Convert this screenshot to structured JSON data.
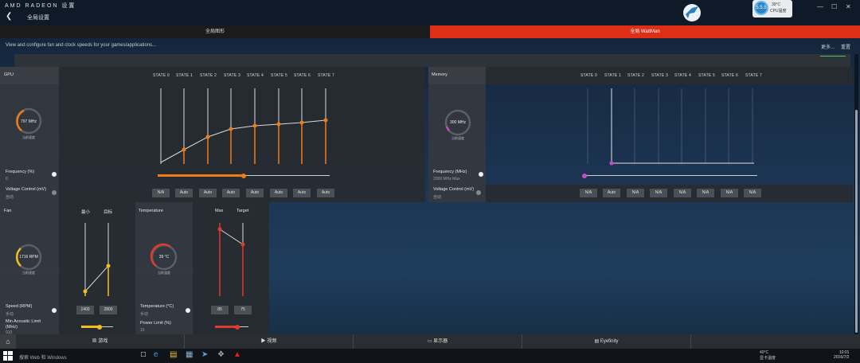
{
  "app": {
    "brand": "AMD RADEON 设置",
    "page": "全局设置",
    "status_ring": "5.5.5",
    "status_temp": "39°C",
    "status_label": "CPU温度",
    "win_min": "—",
    "win_max": "☐",
    "win_close": "✕"
  },
  "tabs": {
    "graphics": "全局图形",
    "wattman": "全局 WattMan"
  },
  "header": {
    "description": "View and configure fan and clock speeds for your games/applications...",
    "more": "更多...",
    "reset": "重置"
  },
  "gpu": {
    "title": "GPU",
    "states": [
      "STATE 0",
      "STATE 1",
      "STATE 2",
      "STATE 3",
      "STATE 4",
      "STATE 5",
      "STATE 6",
      "STATE 7"
    ],
    "gauge_value": "797 MHz",
    "gauge_label": "当前速度",
    "freq_label": "Frequency (%)",
    "freq_value": "0",
    "volt_label": "Voltage Control (mV)",
    "volt_value": "自动",
    "volt_buttons": [
      "N/A",
      "Auto",
      "Auto",
      "Auto",
      "Auto",
      "Auto",
      "Auto",
      "Auto"
    ],
    "slider_value": 0.5
  },
  "memory": {
    "title": "Memory",
    "states": [
      "STATE 0",
      "STATE 1",
      "STATE 2",
      "STATE 3",
      "STATE 4",
      "STATE 5",
      "STATE 6",
      "STATE 7"
    ],
    "gauge_value": "300 MHz",
    "gauge_label": "当前速度",
    "freq_label": "Frequency (MHz)",
    "freq_value": "2000 MHz Max",
    "volt_label": "Voltage Control (mV)",
    "volt_value": "自动",
    "volt_buttons": [
      "N/A",
      "Auto",
      "N/A",
      "N/A",
      "N/A",
      "N/A",
      "N/A",
      "N/A"
    ]
  },
  "fan": {
    "title": "Fan",
    "col_min": "最小",
    "col_target": "目标",
    "gauge_value": "1716 RPM",
    "gauge_label": "当前速度",
    "speed_label": "Speed (RPM)",
    "speed_value": "手动",
    "acoustic_label": "Min Acoustic Limit (MHz)",
    "acoustic_value": "910",
    "min_value": "1400",
    "target_value": "2800"
  },
  "temperature": {
    "title": "Temperature",
    "col_max": "Max",
    "col_target": "Target",
    "gauge_value": "39 °C",
    "gauge_label": "当前温度",
    "temp_label": "Temperature (°C)",
    "temp_value": "手动",
    "power_label": "Power Limit (%)",
    "power_value": "15",
    "max_value": "85",
    "target_value": "75"
  },
  "bottom_tabs": [
    "游戏",
    "视频",
    "显示器",
    "Eyefinity"
  ],
  "taskbar": {
    "search": "搜索 Web 和 Windows",
    "tray_temp": "40°C",
    "tray_label": "显卡温度",
    "time": "10:01",
    "date": "2016/7/2"
  },
  "colors": {
    "accent": "#de2f16",
    "gpu": "#f07d14",
    "memory": "#c84bc8",
    "fan": "#f2c018",
    "temp": "#e03a2c"
  }
}
